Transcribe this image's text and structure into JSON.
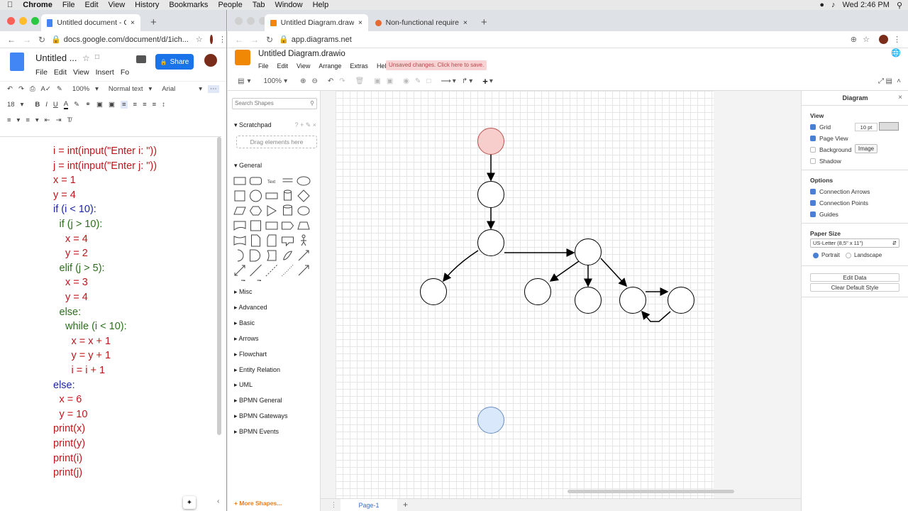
{
  "menubar": {
    "app": "Chrome",
    "items": [
      "File",
      "Edit",
      "View",
      "History",
      "Bookmarks",
      "People",
      "Tab",
      "Window",
      "Help"
    ],
    "clock": "Wed 2:46 PM"
  },
  "left": {
    "tab_title": "Untitled document - Google D",
    "url": "docs.google.com/document/d/1ich...",
    "doc_title": "Untitled ...",
    "share_label": "Share",
    "menu": [
      "File",
      "Edit",
      "View",
      "Insert",
      "Fo"
    ],
    "toolbar": {
      "zoom": "100%",
      "style": "Normal text",
      "font": "Arial",
      "size": "18"
    },
    "code": [
      {
        "t": "i = int(input(\"Enter i: \"))",
        "c": "red",
        "indent": 0
      },
      {
        "t": "j = int(input(\"Enter j: \"))",
        "c": "red",
        "indent": 0
      },
      {
        "t": "x = 1",
        "c": "red",
        "indent": 0
      },
      {
        "t": "y = 4",
        "c": "red",
        "indent": 0
      },
      {
        "t": "if (i < 10):",
        "c": "blue",
        "indent": 0
      },
      {
        "t": "if (j > 10):",
        "c": "green",
        "indent": 1
      },
      {
        "t": "x = 4",
        "c": "red",
        "indent": 2
      },
      {
        "t": "y = 2",
        "c": "red",
        "indent": 2
      },
      {
        "t": "elif (j > 5):",
        "c": "green",
        "indent": 1
      },
      {
        "t": "x = 3",
        "c": "red",
        "indent": 2
      },
      {
        "t": "y = 4",
        "c": "red",
        "indent": 2
      },
      {
        "t": "else:",
        "c": "green",
        "indent": 1
      },
      {
        "t": "while (i < 10):",
        "c": "green",
        "indent": 2
      },
      {
        "t": "x = x + 1",
        "c": "red",
        "indent": 3
      },
      {
        "t": "y = y + 1",
        "c": "red",
        "indent": 3
      },
      {
        "t": "i = i + 1",
        "c": "red",
        "indent": 3
      },
      {
        "t": "else:",
        "c": "blue",
        "indent": 0
      },
      {
        "t": "x = 6",
        "c": "red",
        "indent": 1
      },
      {
        "t": "y = 10",
        "c": "red",
        "indent": 1
      },
      {
        "t": "print(x)",
        "c": "red",
        "indent": 0
      },
      {
        "t": "print(y)",
        "c": "red",
        "indent": 0
      },
      {
        "t": "print(i)",
        "c": "red",
        "indent": 0
      },
      {
        "t": "print(j)",
        "c": "red",
        "indent": 0
      }
    ]
  },
  "right": {
    "tab1": "Untitled Diagram.drawio - diag",
    "tab2": "Non-functional requirements -",
    "url": "app.diagrams.net",
    "title": "Untitled Diagram.drawio",
    "menu": [
      "File",
      "Edit",
      "View",
      "Arrange",
      "Extras",
      "Help"
    ],
    "unsaved": "Unsaved changes. Click here to save.",
    "zoom": "100%",
    "search_placeholder": "Search Shapes",
    "scratchpad": "Scratchpad",
    "drag_hint": "Drag elements here",
    "general": "General",
    "sections": [
      "Misc",
      "Advanced",
      "Basic",
      "Arrows",
      "Flowchart",
      "Entity Relation",
      "UML",
      "BPMN General",
      "BPMN Gateways",
      "BPMN Events"
    ],
    "more_shapes": "+ More Shapes...",
    "page_tab": "Page-1",
    "format": {
      "title": "Diagram",
      "view": "View",
      "grid": "Grid",
      "grid_size": "10 pt",
      "page_view": "Page View",
      "background": "Background",
      "image_btn": "Image",
      "shadow": "Shadow",
      "options": "Options",
      "conn_arrows": "Connection Arrows",
      "conn_points": "Connection Points",
      "guides": "Guides",
      "paper_size": "Paper Size",
      "paper_value": "US-Letter (8,5\" x 11\")",
      "portrait": "Portrait",
      "landscape": "Landscape",
      "edit_data": "Edit Data",
      "clear_style": "Clear Default Style"
    }
  },
  "colors": {
    "accent": "#1a73e8",
    "drawio_orange": "#f08705",
    "node_red": "#f8cecc",
    "node_blue": "#dae8fc",
    "unsaved_bg": "#f8d3d3"
  }
}
